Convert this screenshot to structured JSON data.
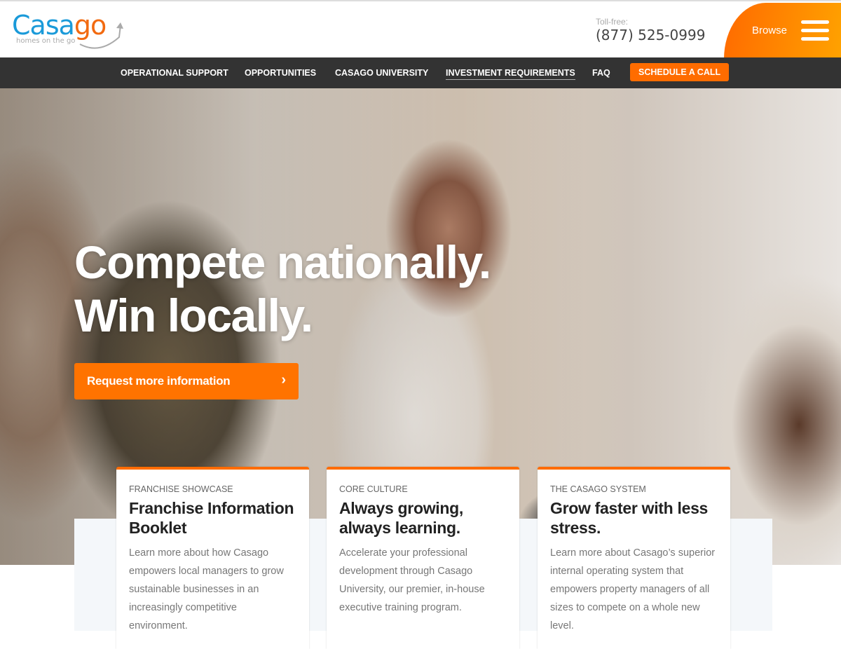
{
  "brand": {
    "name_part1": "Casa",
    "name_part2": "go",
    "tagline": "homes on the go"
  },
  "header": {
    "tollfree_label": "Toll-free:",
    "phone": "(877) 525-0999",
    "browse_label": "Browse"
  },
  "nav": {
    "items": [
      "OPERATIONAL SUPPORT",
      "OPPORTUNITIES",
      "CASAGO UNIVERSITY",
      "INVESTMENT REQUIREMENTS",
      "FAQ"
    ],
    "cta": "SCHEDULE A CALL"
  },
  "hero": {
    "line1": "Compete nationally.",
    "line2": "Win locally.",
    "button": "Request more information",
    "button_icon": "chevron-right"
  },
  "cards": [
    {
      "kicker": "FRANCHISE SHOWCASE",
      "title": "Franchise Information Booklet",
      "desc": "Learn more about how Casago empowers local managers to grow sustainable businesses in an increasingly competitive environment."
    },
    {
      "kicker": "CORE CULTURE",
      "title": "Always growing, always learning.",
      "desc": "Accelerate your professional development through Casago University, our premier, in-house executive training program."
    },
    {
      "kicker": "THE CASAGO SYSTEM",
      "title": "Grow faster with less stress.",
      "desc": "Learn more about Casago’s superior internal operating system that empowers property managers of all sizes to compete on a whole new level."
    }
  ],
  "colors": {
    "accent": "#ff6c00",
    "blue": "#1a9ad9",
    "nav_bg": "#333333"
  }
}
